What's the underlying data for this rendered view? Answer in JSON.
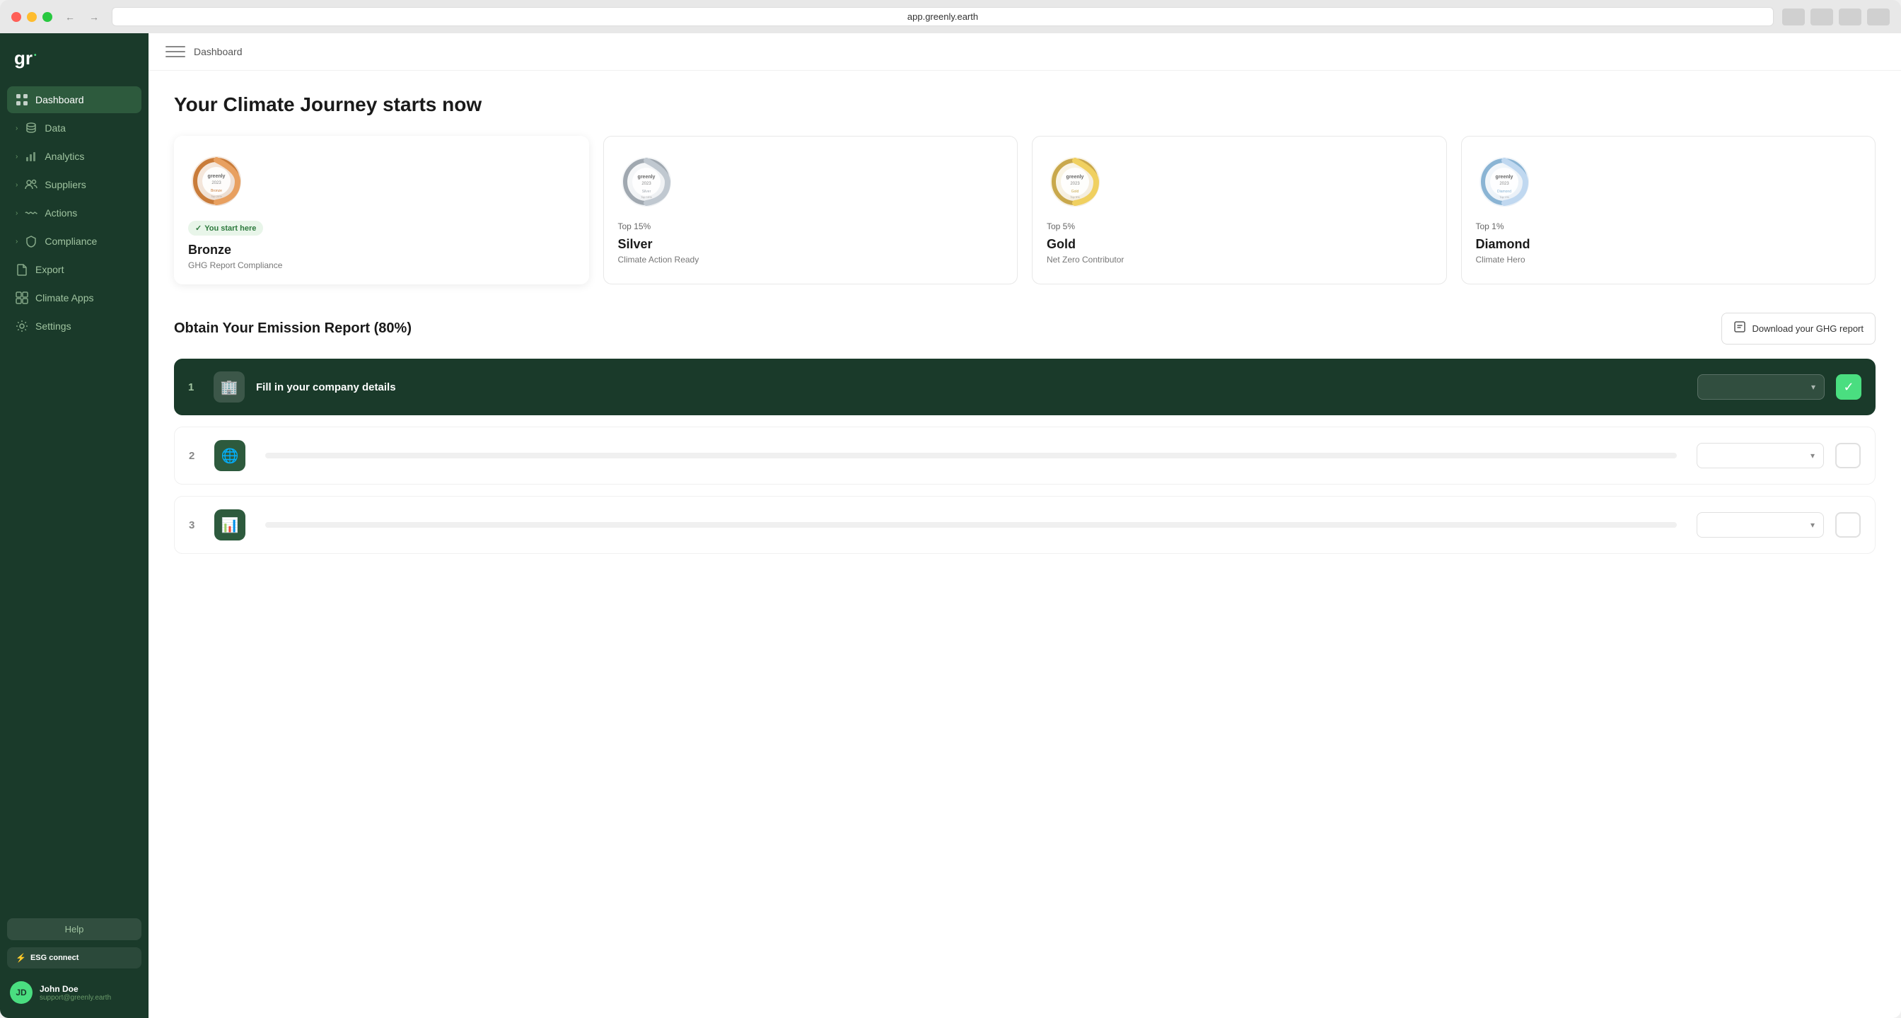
{
  "browser": {
    "address": "app.greenly.earth"
  },
  "sidebar": {
    "logo": "gr",
    "logo_dot": "•",
    "nav_items": [
      {
        "id": "dashboard",
        "label": "Dashboard",
        "active": true,
        "icon": "grid"
      },
      {
        "id": "data",
        "label": "Data",
        "active": false,
        "icon": "database"
      },
      {
        "id": "analytics",
        "label": "Analytics",
        "active": false,
        "icon": "bar-chart"
      },
      {
        "id": "suppliers",
        "label": "Suppliers",
        "active": false,
        "icon": "people"
      },
      {
        "id": "actions",
        "label": "Actions",
        "active": false,
        "icon": "wave"
      },
      {
        "id": "compliance",
        "label": "Compliance",
        "active": false,
        "icon": "shield"
      },
      {
        "id": "export",
        "label": "Export",
        "active": false,
        "icon": "file"
      },
      {
        "id": "climate-apps",
        "label": "Climate Apps",
        "active": false,
        "icon": "apps"
      },
      {
        "id": "settings",
        "label": "Settings",
        "active": false,
        "icon": "gear"
      }
    ],
    "help_label": "Help",
    "esg_label": "ESG connect",
    "user": {
      "name": "John Doe",
      "email": "support@greenly.earth",
      "initials": "JD"
    }
  },
  "topbar": {
    "breadcrumb": "Dashboard"
  },
  "page": {
    "title": "Your Climate Journey starts now",
    "journey_cards": [
      {
        "id": "bronze",
        "tier": "Bronze",
        "description": "GHG Report Compliance",
        "top_percent": null,
        "you_start": true,
        "color": "#c97c3a",
        "medal_color": "#c97c3a"
      },
      {
        "id": "silver",
        "tier": "Silver",
        "description": "Climate Action Ready",
        "top_percent": "Top 15%",
        "you_start": false,
        "color": "#a0a8b0",
        "medal_color": "#a0a8b0"
      },
      {
        "id": "gold",
        "tier": "Gold",
        "description": "Net Zero Contributor",
        "top_percent": "Top 5%",
        "you_start": false,
        "color": "#c9a84c",
        "medal_color": "#c9a84c"
      },
      {
        "id": "diamond",
        "tier": "Diamond",
        "description": "Climate Hero",
        "top_percent": "Top 1%",
        "you_start": false,
        "color": "#8ab4d4",
        "medal_color": "#8ab4d4"
      }
    ],
    "emission_section": {
      "title": "Obtain Your Emission Report (80%)",
      "download_label": "Download your GHG report",
      "steps": [
        {
          "number": "1",
          "label": "Fill in your company details",
          "active": true,
          "icon": "🏢",
          "completed": true
        },
        {
          "number": "2",
          "label": "",
          "active": false,
          "icon": "🌐",
          "completed": false
        },
        {
          "number": "3",
          "label": "",
          "active": false,
          "icon": "📊",
          "completed": false
        }
      ]
    }
  }
}
